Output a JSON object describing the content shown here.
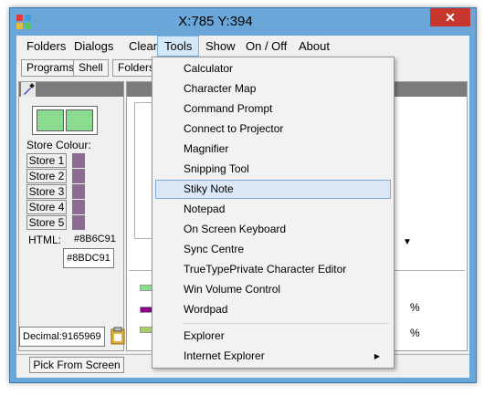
{
  "window": {
    "title": "X:785 Y:394",
    "close_glyph": "✕"
  },
  "menubar": {
    "items": [
      "Folders",
      "Dialogs",
      "Clear",
      "Tools",
      "Show",
      "On / Off",
      "About"
    ],
    "active": "Tools"
  },
  "tabs": [
    "Programs",
    "Shell",
    "Folders"
  ],
  "colour_panel": {
    "store_label": "Store Colour:",
    "store_buttons": [
      "Store 1",
      "Store 2",
      "Store 3",
      "Store 4",
      "Store 5"
    ],
    "store_colour": "#8B6C91",
    "preview_colour": "#8BDC91",
    "html_label": "HTML:",
    "html_value": "#8B6C91",
    "hex_box_value": "#8BDC91",
    "decimal_value": "Decimal:9165969"
  },
  "right_panel": {
    "percent_labels": [
      "%",
      "%"
    ]
  },
  "bottom": {
    "pick_label": "Pick From Screen"
  },
  "tools_menu": {
    "items": [
      {
        "label": "Calculator"
      },
      {
        "label": "Character Map"
      },
      {
        "label": "Command Prompt"
      },
      {
        "label": "Connect to Projector"
      },
      {
        "label": "Magnifier"
      },
      {
        "label": "Snipping Tool"
      },
      {
        "label": "Stiky Note",
        "highlighted": true
      },
      {
        "label": "Notepad"
      },
      {
        "label": "On Screen Keyboard"
      },
      {
        "label": "Sync Centre"
      },
      {
        "label": "TrueTypePrivate Character Editor"
      },
      {
        "label": "Win Volume Control"
      },
      {
        "label": "Wordpad"
      }
    ],
    "items_after_separator": [
      {
        "label": "Explorer"
      },
      {
        "label": "Internet Explorer",
        "submenu": true
      }
    ],
    "submenu_glyph": "▶"
  },
  "colors": {
    "titlebar": "#6AA7D8",
    "close": "#C7372D",
    "menu_highlight": "#DCE8F7",
    "bar_green": "#8BDC91",
    "bar_purple": "#8B008B"
  }
}
